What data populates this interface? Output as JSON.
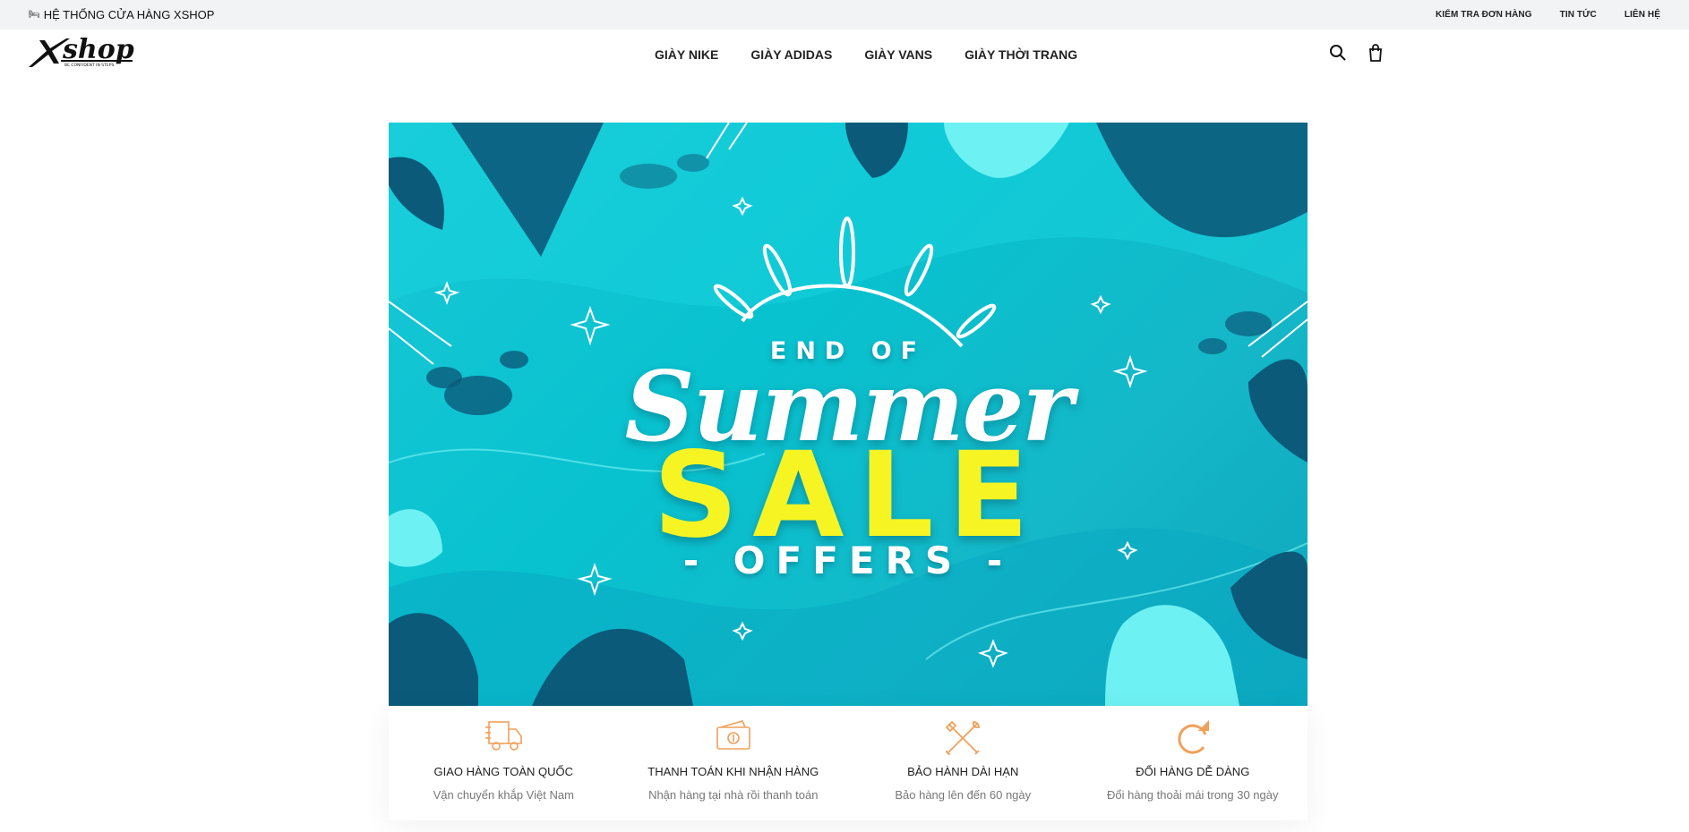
{
  "topbar": {
    "store_icon": "bed-icon",
    "store_label": "HỆ THỐNG CỬA HÀNG XSHOP",
    "links": [
      "KIỂM TRA ĐƠN HÀNG",
      "TIN TỨC",
      "LIÊN HỆ"
    ]
  },
  "header": {
    "logo_text": "shop",
    "logo_tagline": "BE CONFIDENT IN STEPS",
    "nav": [
      "GIÀY NIKE",
      "GIÀY ADIDAS",
      "GIÀY VANS",
      "GIÀY THỜI TRANG"
    ],
    "icons": [
      "search-icon",
      "cart-icon"
    ]
  },
  "banner": {
    "line1": "END OF",
    "line2": "Summer",
    "line3": "SALE",
    "line4": "- OFFERS -",
    "colors": {
      "background": "#0cc3d2",
      "sale_text": "#f6f523",
      "leaf_dark": "#0b5a7a",
      "leaf_light": "#6ef1f3"
    }
  },
  "features": [
    {
      "icon": "delivery-truck-icon",
      "title": "GIAO HÀNG TOÀN QUỐC",
      "subtitle": "Vận chuyển khắp Việt Nam"
    },
    {
      "icon": "wallet-icon",
      "title": "THANH TOÁN KHI NHẬN HÀNG",
      "subtitle": "Nhận hàng tại nhà rồi thanh toán"
    },
    {
      "icon": "tools-icon",
      "title": "BẢO HÀNH DÀI HẠN",
      "subtitle": "Bảo hàng lên đến 60 ngày"
    },
    {
      "icon": "refresh-icon",
      "title": "ĐỔI HÀNG DỄ DÀNG",
      "subtitle": "Đổi hàng thoải mái trong 30 ngày"
    }
  ],
  "accent_color": "#f0a05a"
}
